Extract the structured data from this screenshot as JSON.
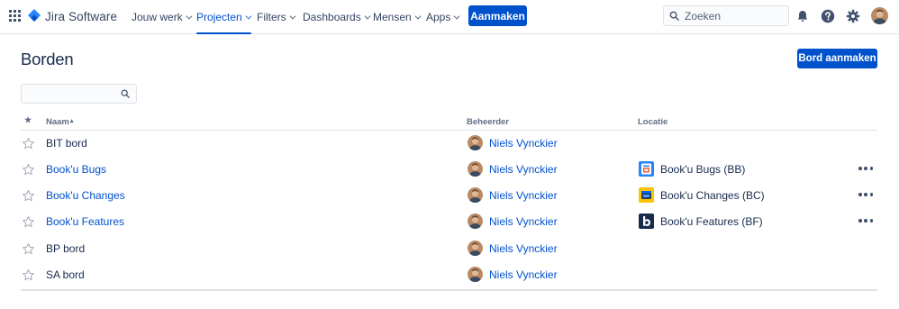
{
  "header": {
    "product_name": "Jira Software",
    "nav": [
      {
        "label": "Jouw werk",
        "active": false
      },
      {
        "label": "Projecten",
        "active": true
      },
      {
        "label": "Filters",
        "active": false
      },
      {
        "label": "Dashboards",
        "active": false
      },
      {
        "label": "Mensen",
        "active": false
      },
      {
        "label": "Apps",
        "active": false
      }
    ],
    "create_label": "Aanmaken",
    "search_placeholder": "Zoeken",
    "icons": [
      "notifications-icon",
      "help-icon",
      "settings-icon"
    ],
    "accent_color": "#0052cc"
  },
  "page": {
    "title": "Borden",
    "create_board_label": "Bord aanmaken",
    "filter_value": ""
  },
  "table": {
    "columns": {
      "favourite": "★",
      "name": "Naam",
      "name_sort": "▴",
      "admin": "Beheerder",
      "location": "Locatie"
    },
    "rows": [
      {
        "name": "BIT bord",
        "link": false,
        "admin": "Niels Vynckier",
        "location": "",
        "location_icon": "",
        "actions": false
      },
      {
        "name": "Book'u Bugs",
        "link": true,
        "admin": "Niels Vynckier",
        "location": "Book'u Bugs (BB)",
        "location_icon": "project-bugs-icon",
        "actions": true
      },
      {
        "name": "Book'u Changes",
        "link": true,
        "admin": "Niels Vynckier",
        "location": "Book'u Changes (BC)",
        "location_icon": "project-changes-icon",
        "actions": true
      },
      {
        "name": "Book'u Features",
        "link": true,
        "admin": "Niels Vynckier",
        "location": "Book'u Features (BF)",
        "location_icon": "project-features-icon",
        "actions": true
      },
      {
        "name": "BP bord",
        "link": false,
        "admin": "Niels Vynckier",
        "location": "",
        "location_icon": "",
        "actions": false
      },
      {
        "name": "SA bord",
        "link": false,
        "admin": "Niels Vynckier",
        "location": "",
        "location_icon": "",
        "actions": false
      }
    ]
  }
}
